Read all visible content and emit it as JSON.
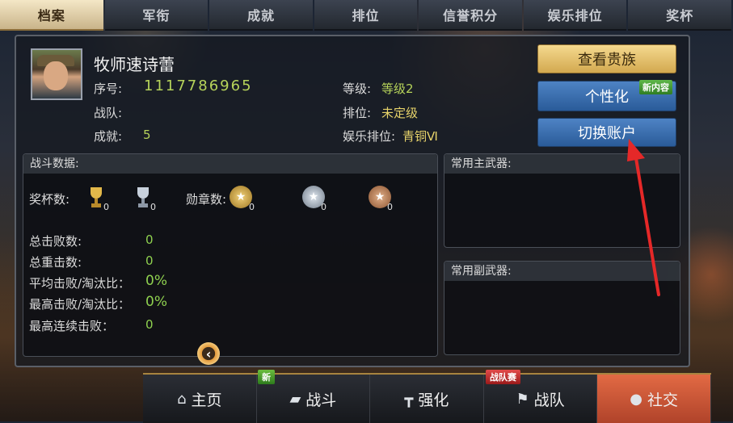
{
  "tabs": [
    "档案",
    "军衔",
    "成就",
    "排位",
    "信誉积分",
    "娱乐排位",
    "奖杯"
  ],
  "profile": {
    "name": "牧师速诗蕾",
    "serial_label": "序号:",
    "serial_value": "1117786965",
    "team_label": "战队:",
    "team_value": "",
    "achievement_label": "成就:",
    "achievement_value": "5",
    "level_label": "等级:",
    "level_value": "等级2",
    "rank_label": "排位:",
    "rank_value": "未定级",
    "fun_rank_label": "娱乐排位:",
    "fun_rank_value": "青铜Ⅵ"
  },
  "buttons": {
    "view_noble": "查看贵族",
    "personalize": "个性化",
    "personalize_badge": "新内容",
    "switch_account": "切换账户"
  },
  "battle": {
    "title": "战斗数据:",
    "trophy_label": "奖杯数:",
    "medal_label": "勋章数:",
    "trophy_counts": [
      "0",
      "0"
    ],
    "medal_counts": [
      "0",
      "0",
      "0"
    ],
    "stats": [
      {
        "label": "总击败数:",
        "value": "0"
      },
      {
        "label": "总重击数:",
        "value": "0"
      },
      {
        "label": "平均击败/淘汰比：",
        "value": "0%"
      },
      {
        "label": "最高击败/淘汰比：",
        "value": "0%"
      },
      {
        "label": "最高连续击败：",
        "value": "0"
      }
    ]
  },
  "weapons": {
    "primary_title": "常用主武器:",
    "secondary_title": "常用副武器:"
  },
  "nav": {
    "items": [
      "主页",
      "战斗",
      "强化",
      "战队",
      "社交"
    ],
    "badge_new": "新",
    "badge_team": "战队赛"
  },
  "colors": {
    "accent_gold": "#d3a94f",
    "accent_blue": "#2a5b99",
    "active_nav": "#e26a44",
    "stat_green": "#8fd14f",
    "arrow_red": "#e52828"
  },
  "icons": {
    "home": "home-icon",
    "battle": "gun-icon",
    "upgrade": "hammer-icon",
    "team": "flag-icon",
    "social": "people-icon",
    "back": "chevron-left-icon"
  }
}
